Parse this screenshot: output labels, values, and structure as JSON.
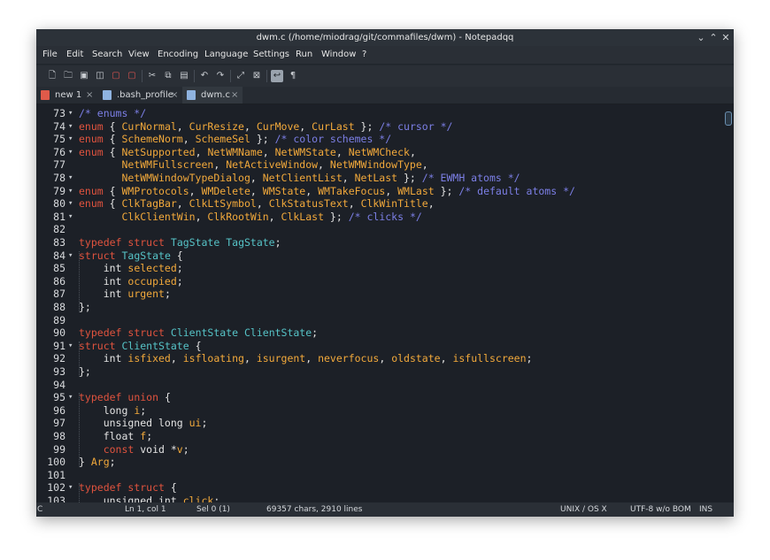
{
  "window": {
    "title": "dwm.c (/home/miodrag/git/commafiles/dwm) - Notepadqq"
  },
  "controls": {
    "minimize": "⌄",
    "maximize": "⌃",
    "close": "✕"
  },
  "menu": [
    "File",
    "Edit",
    "Search",
    "View",
    "Encoding",
    "Language",
    "Settings",
    "Run",
    "Window",
    "?"
  ],
  "toolbar_icons": [
    "new-file-icon",
    "open-file-icon",
    "save-icon",
    "save-all-icon",
    "close-file-icon",
    "close-all-icon",
    "cut-icon",
    "copy-icon",
    "paste-icon",
    "undo-icon",
    "redo-icon",
    "zoom-in-icon",
    "zoom-out-icon",
    "word-wrap-icon",
    "show-all-chars-icon"
  ],
  "tabs": [
    {
      "label": "new 1",
      "close": "×",
      "icon_color": "#e05a4a"
    },
    {
      "label": ".bash_profile",
      "close": "×",
      "icon_color": "#8fb3e0"
    },
    {
      "label": "dwm.c",
      "close": "×",
      "icon_color": "#8fb3e0",
      "active": true
    }
  ],
  "code": {
    "lines": [
      {
        "num": "73",
        "fold": "▾",
        "tokens": [
          [
            "cm",
            "/* enums */"
          ]
        ]
      },
      {
        "num": "74",
        "fold": "▾",
        "tokens": [
          [
            "kw",
            "enum"
          ],
          [
            "pl",
            " { "
          ],
          [
            "id",
            "CurNormal"
          ],
          [
            "pl",
            ", "
          ],
          [
            "id",
            "CurResize"
          ],
          [
            "pl",
            ", "
          ],
          [
            "id",
            "CurMove"
          ],
          [
            "pl",
            ", "
          ],
          [
            "id",
            "CurLast"
          ],
          [
            "pl",
            " }; "
          ],
          [
            "cm",
            "/* cursor */"
          ]
        ]
      },
      {
        "num": "75",
        "fold": "▾",
        "tokens": [
          [
            "kw",
            "enum"
          ],
          [
            "pl",
            " { "
          ],
          [
            "id",
            "SchemeNorm"
          ],
          [
            "pl",
            ", "
          ],
          [
            "id",
            "SchemeSel"
          ],
          [
            "pl",
            " }; "
          ],
          [
            "cm",
            "/* color schemes */"
          ]
        ]
      },
      {
        "num": "76",
        "fold": "▾",
        "tokens": [
          [
            "kw",
            "enum"
          ],
          [
            "pl",
            " { "
          ],
          [
            "id",
            "NetSupported"
          ],
          [
            "pl",
            ", "
          ],
          [
            "id",
            "NetWMName"
          ],
          [
            "pl",
            ", "
          ],
          [
            "id",
            "NetWMState"
          ],
          [
            "pl",
            ", "
          ],
          [
            "id",
            "NetWMCheck"
          ],
          [
            "pl",
            ","
          ]
        ]
      },
      {
        "num": "77",
        "fold": "",
        "tokens": [
          [
            "pl",
            "       "
          ],
          [
            "id",
            "NetWMFullscreen"
          ],
          [
            "pl",
            ", "
          ],
          [
            "id",
            "NetActiveWindow"
          ],
          [
            "pl",
            ", "
          ],
          [
            "id",
            "NetWMWindowType"
          ],
          [
            "pl",
            ","
          ]
        ]
      },
      {
        "num": "78",
        "fold": "▾",
        "tokens": [
          [
            "pl",
            "       "
          ],
          [
            "id",
            "NetWMWindowTypeDialog"
          ],
          [
            "pl",
            ", "
          ],
          [
            "id",
            "NetClientList"
          ],
          [
            "pl",
            ", "
          ],
          [
            "id",
            "NetLast"
          ],
          [
            "pl",
            " }; "
          ],
          [
            "cm",
            "/* EWMH atoms */"
          ]
        ]
      },
      {
        "num": "79",
        "fold": "▾",
        "tokens": [
          [
            "kw",
            "enum"
          ],
          [
            "pl",
            " { "
          ],
          [
            "id",
            "WMProtocols"
          ],
          [
            "pl",
            ", "
          ],
          [
            "id",
            "WMDelete"
          ],
          [
            "pl",
            ", "
          ],
          [
            "id",
            "WMState"
          ],
          [
            "pl",
            ", "
          ],
          [
            "id",
            "WMTakeFocus"
          ],
          [
            "pl",
            ", "
          ],
          [
            "id",
            "WMLast"
          ],
          [
            "pl",
            " }; "
          ],
          [
            "cm",
            "/* default atoms */"
          ]
        ]
      },
      {
        "num": "80",
        "fold": "▾",
        "tokens": [
          [
            "kw",
            "enum"
          ],
          [
            "pl",
            " { "
          ],
          [
            "id",
            "ClkTagBar"
          ],
          [
            "pl",
            ", "
          ],
          [
            "id",
            "ClkLtSymbol"
          ],
          [
            "pl",
            ", "
          ],
          [
            "id",
            "ClkStatusText"
          ],
          [
            "pl",
            ", "
          ],
          [
            "id",
            "ClkWinTitle"
          ],
          [
            "pl",
            ","
          ]
        ]
      },
      {
        "num": "81",
        "fold": "▾",
        "tokens": [
          [
            "pl",
            "       "
          ],
          [
            "id",
            "ClkClientWin"
          ],
          [
            "pl",
            ", "
          ],
          [
            "id",
            "ClkRootWin"
          ],
          [
            "pl",
            ", "
          ],
          [
            "id",
            "ClkLast"
          ],
          [
            "pl",
            " }; "
          ],
          [
            "cm",
            "/* clicks */"
          ]
        ]
      },
      {
        "num": "82",
        "fold": "",
        "tokens": []
      },
      {
        "num": "83",
        "fold": "",
        "tokens": [
          [
            "kw",
            "typedef"
          ],
          [
            "pl",
            " "
          ],
          [
            "kw",
            "struct"
          ],
          [
            "pl",
            " "
          ],
          [
            "ty",
            "TagState"
          ],
          [
            "pl",
            " "
          ],
          [
            "ty",
            "TagState"
          ],
          [
            "pl",
            ";"
          ]
        ]
      },
      {
        "num": "84",
        "fold": "▾",
        "tokens": [
          [
            "kw",
            "struct"
          ],
          [
            "pl",
            " "
          ],
          [
            "ty",
            "TagState"
          ],
          [
            "pl",
            " {"
          ]
        ]
      },
      {
        "num": "85",
        "fold": "",
        "tokens": [
          [
            "pl",
            "    int "
          ],
          [
            "id",
            "selected"
          ],
          [
            "pl",
            ";"
          ]
        ]
      },
      {
        "num": "86",
        "fold": "",
        "tokens": [
          [
            "pl",
            "    int "
          ],
          [
            "id",
            "occupied"
          ],
          [
            "pl",
            ";"
          ]
        ]
      },
      {
        "num": "87",
        "fold": "",
        "tokens": [
          [
            "pl",
            "    int "
          ],
          [
            "id",
            "urgent"
          ],
          [
            "pl",
            ";"
          ]
        ]
      },
      {
        "num": "88",
        "fold": "",
        "tokens": [
          [
            "pl",
            "};"
          ]
        ]
      },
      {
        "num": "89",
        "fold": "",
        "tokens": []
      },
      {
        "num": "90",
        "fold": "",
        "tokens": [
          [
            "kw",
            "typedef"
          ],
          [
            "pl",
            " "
          ],
          [
            "kw",
            "struct"
          ],
          [
            "pl",
            " "
          ],
          [
            "ty",
            "ClientState"
          ],
          [
            "pl",
            " "
          ],
          [
            "ty",
            "ClientState"
          ],
          [
            "pl",
            ";"
          ]
        ]
      },
      {
        "num": "91",
        "fold": "▾",
        "tokens": [
          [
            "kw",
            "struct"
          ],
          [
            "pl",
            " "
          ],
          [
            "ty",
            "ClientState"
          ],
          [
            "pl",
            " {"
          ]
        ]
      },
      {
        "num": "92",
        "fold": "",
        "tokens": [
          [
            "pl",
            "    int "
          ],
          [
            "id",
            "isfixed"
          ],
          [
            "pl",
            ", "
          ],
          [
            "id",
            "isfloating"
          ],
          [
            "pl",
            ", "
          ],
          [
            "id",
            "isurgent"
          ],
          [
            "pl",
            ", "
          ],
          [
            "id",
            "neverfocus"
          ],
          [
            "pl",
            ", "
          ],
          [
            "id",
            "oldstate"
          ],
          [
            "pl",
            ", "
          ],
          [
            "id",
            "isfullscreen"
          ],
          [
            "pl",
            ";"
          ]
        ]
      },
      {
        "num": "93",
        "fold": "",
        "tokens": [
          [
            "pl",
            "};"
          ]
        ]
      },
      {
        "num": "94",
        "fold": "",
        "tokens": []
      },
      {
        "num": "95",
        "fold": "▾",
        "tokens": [
          [
            "kw",
            "typedef"
          ],
          [
            "pl",
            " "
          ],
          [
            "kw",
            "union"
          ],
          [
            "pl",
            " {"
          ]
        ]
      },
      {
        "num": "96",
        "fold": "",
        "tokens": [
          [
            "pl",
            "    long "
          ],
          [
            "id",
            "i"
          ],
          [
            "pl",
            ";"
          ]
        ]
      },
      {
        "num": "97",
        "fold": "",
        "tokens": [
          [
            "pl",
            "    unsigned long "
          ],
          [
            "id",
            "ui"
          ],
          [
            "pl",
            ";"
          ]
        ]
      },
      {
        "num": "98",
        "fold": "",
        "tokens": [
          [
            "pl",
            "    float "
          ],
          [
            "id",
            "f"
          ],
          [
            "pl",
            ";"
          ]
        ]
      },
      {
        "num": "99",
        "fold": "",
        "tokens": [
          [
            "pl",
            "    "
          ],
          [
            "kw",
            "const"
          ],
          [
            "pl",
            " void *"
          ],
          [
            "id",
            "v"
          ],
          [
            "pl",
            ";"
          ]
        ]
      },
      {
        "num": "100",
        "fold": "",
        "tokens": [
          [
            "pl",
            "} "
          ],
          [
            "id",
            "Arg"
          ],
          [
            "pl",
            ";"
          ]
        ]
      },
      {
        "num": "101",
        "fold": "",
        "tokens": []
      },
      {
        "num": "102",
        "fold": "▾",
        "tokens": [
          [
            "kw",
            "typedef"
          ],
          [
            "pl",
            " "
          ],
          [
            "kw",
            "struct"
          ],
          [
            "pl",
            " {"
          ]
        ]
      },
      {
        "num": "103",
        "fold": "",
        "tokens": [
          [
            "pl",
            "    unsigned int "
          ],
          [
            "id",
            "click"
          ],
          [
            "pl",
            ";"
          ]
        ]
      }
    ]
  },
  "status": {
    "mode": "C",
    "position": "Ln 1, col 1",
    "selection": "Sel 0 (1)",
    "chars": "69357 chars, 2910 lines",
    "eol": "UNIX / OS X",
    "encoding": "UTF-8 w/o BOM",
    "insert": "INS"
  }
}
